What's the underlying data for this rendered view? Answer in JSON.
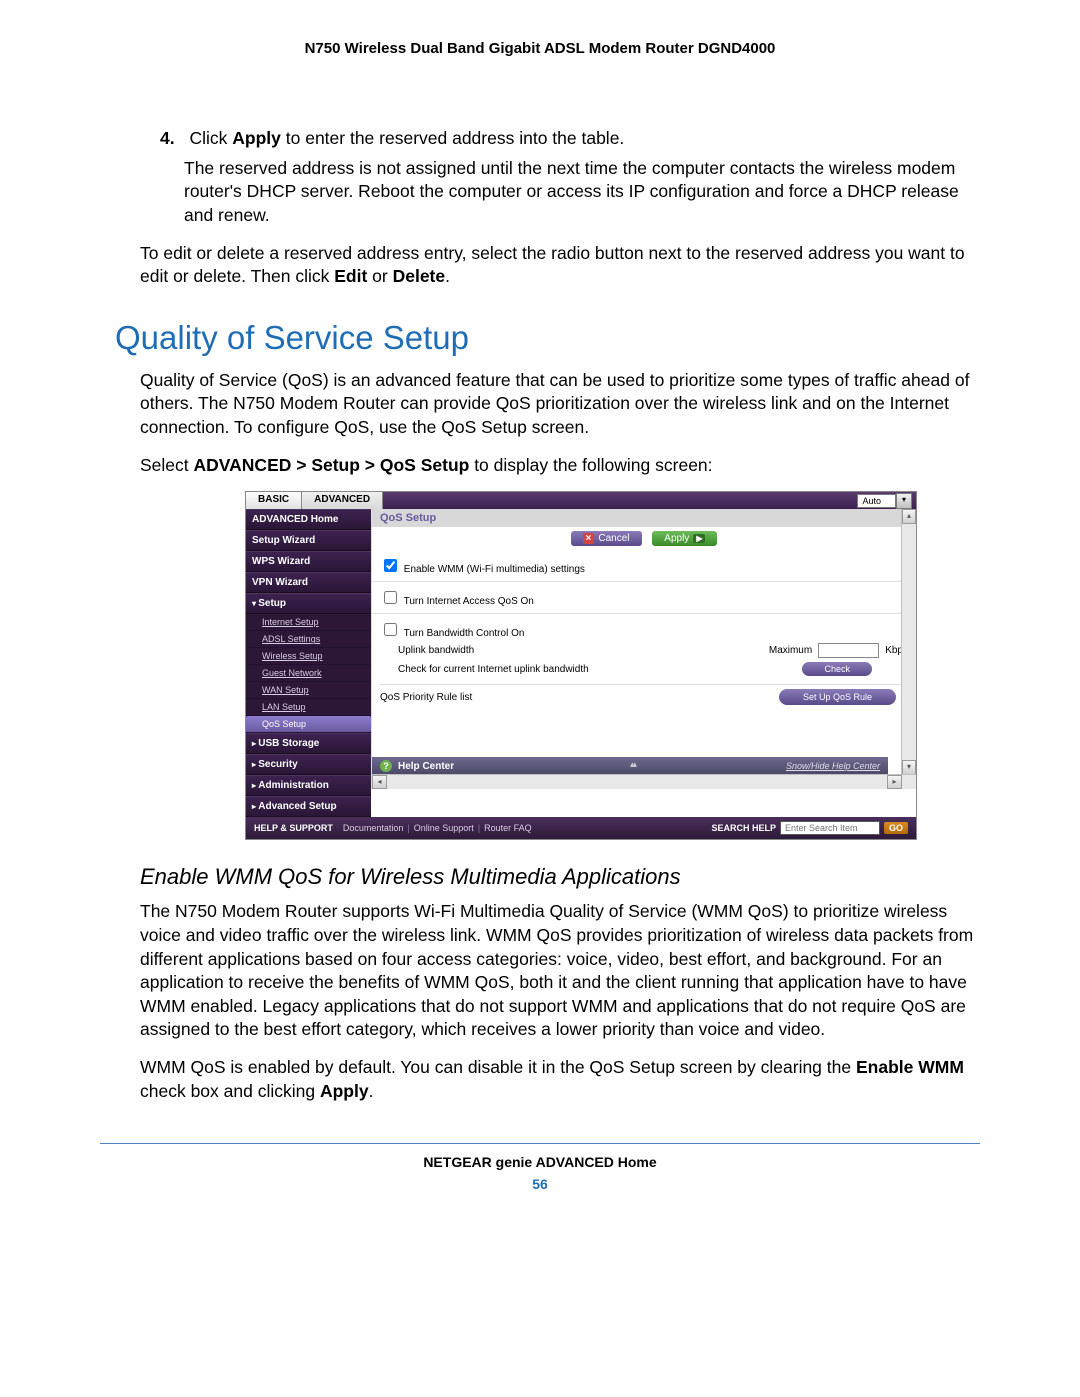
{
  "doc_header": "N750 Wireless Dual Band Gigabit ADSL Modem Router DGND4000",
  "step4_num": "4.",
  "step4_a": "Click ",
  "step4_b": "Apply",
  "step4_c": " to enter the reserved address into the table.",
  "step4_para": "The reserved address is not assigned until the next time the computer contacts the wireless modem router's DHCP server. Reboot the computer or access its IP configuration and force a DHCP release and renew.",
  "edit_para_a": "To edit or delete a reserved address entry, select the radio button next to the reserved address you want to edit or delete. Then click ",
  "edit_para_b": "Edit",
  "edit_para_c": " or ",
  "edit_para_d": "Delete",
  "edit_para_e": ".",
  "h1": "Quality of Service Setup",
  "qos_intro": "Quality of Service (QoS) is an advanced feature that can be used to prioritize some types of traffic ahead of others. The N750 Modem Router can provide QoS prioritization over the wireless link and on the Internet connection. To configure QoS, use the QoS Setup screen.",
  "select_a": "Select ",
  "select_b": "ADVANCED > Setup > QoS Setup",
  "select_c": " to display the following screen:",
  "ui": {
    "tab_basic": "BASIC",
    "tab_advanced": "ADVANCED",
    "lang": "Auto",
    "side_adv_home": "ADVANCED Home",
    "side_setup_wiz": "Setup Wizard",
    "side_wps": "WPS Wizard",
    "side_vpn": "VPN Wizard",
    "side_setup": "Setup",
    "sub_internet": "Internet Setup",
    "sub_adsl": "ADSL Settings",
    "sub_wireless": "Wireless Setup",
    "sub_guest": "Guest Network",
    "sub_wan": "WAN Setup",
    "sub_lan": "LAN Setup",
    "sub_qos": "QoS Setup",
    "side_usb": "USB Storage",
    "side_security": "Security",
    "side_admin": "Administration",
    "side_advsetup": "Advanced Setup",
    "title": "QoS Setup",
    "cancel": "Cancel",
    "apply": "Apply",
    "chk_wmm": "Enable WMM (Wi-Fi multimedia) settings",
    "chk_internet_qos": "Turn Internet Access QoS On",
    "chk_bw": "Turn Bandwidth Control On",
    "uplink_lbl": "Uplink bandwidth",
    "max_lbl": "Maximum",
    "kbps": "Kbps",
    "check_lbl": "Check for current Internet uplink bandwidth",
    "check_btn": "Check",
    "rule_list": "QoS Priority Rule list",
    "setup_rule": "Set Up QoS Rule",
    "help_center": "Help Center",
    "help_link": "Snow/Hide Help Center",
    "hs": "HELP & SUPPORT",
    "doc_link": "Documentation",
    "online_link": "Online Support",
    "faq_link": "Router FAQ",
    "search_help": "SEARCH HELP",
    "search_placeholder": "Enter Search Item",
    "go": "GO"
  },
  "h2": "Enable WMM QoS for Wireless Multimedia Applications",
  "wmm_para1": "The N750 Modem Router supports Wi-Fi Multimedia Quality of Service (WMM QoS) to prioritize wireless voice and video traffic over the wireless link. WMM QoS provides prioritization of wireless data packets from different applications based on four access categories: voice, video, best effort, and background. For an application to receive the benefits of WMM QoS, both it and the client running that application have to have WMM enabled. Legacy applications that do not support WMM and applications that do not require QoS are assigned to the best effort category, which receives a lower priority than voice and video.",
  "wmm2_a": "WMM QoS is enabled by default. You can disable it in the QoS Setup screen by clearing the ",
  "wmm2_b": "Enable WMM",
  "wmm2_c": " check box and clicking ",
  "wmm2_d": "Apply",
  "wmm2_e": ".",
  "footer_title": "NETGEAR genie ADVANCED Home",
  "page_num": "56"
}
